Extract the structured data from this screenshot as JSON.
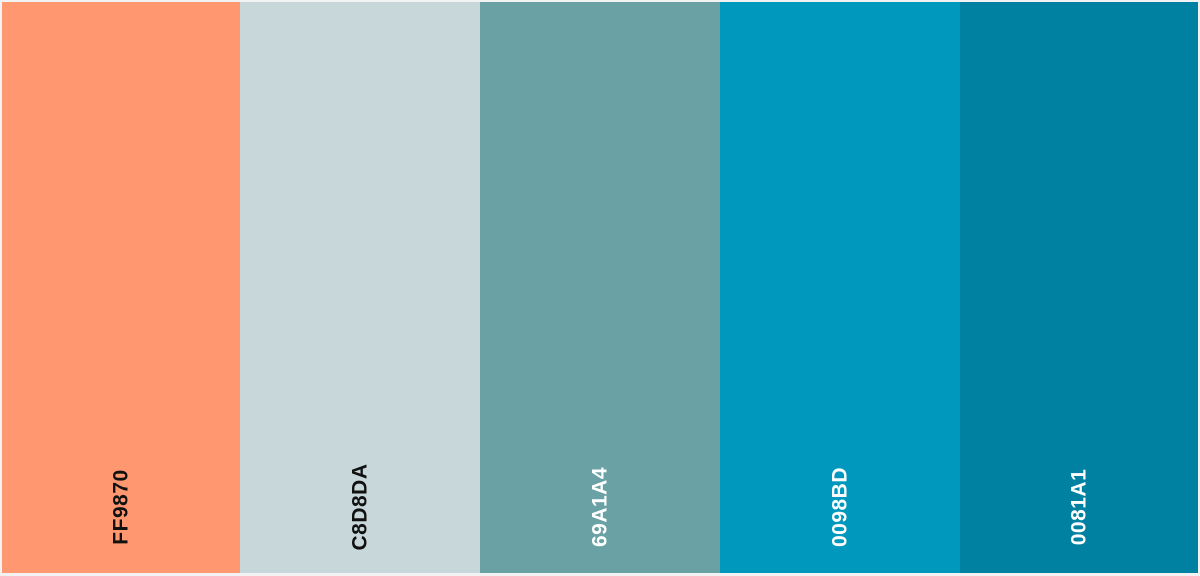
{
  "palette": {
    "swatches": [
      {
        "hex_label": "FF9870",
        "color": "#FF9870"
      },
      {
        "hex_label": "C8D8DA",
        "color": "#C8D8DA"
      },
      {
        "hex_label": "69A1A4",
        "color": "#69A1A4"
      },
      {
        "hex_label": "0098BD",
        "color": "#0098BD"
      },
      {
        "hex_label": "0081A1",
        "color": "#0081A1"
      }
    ]
  }
}
